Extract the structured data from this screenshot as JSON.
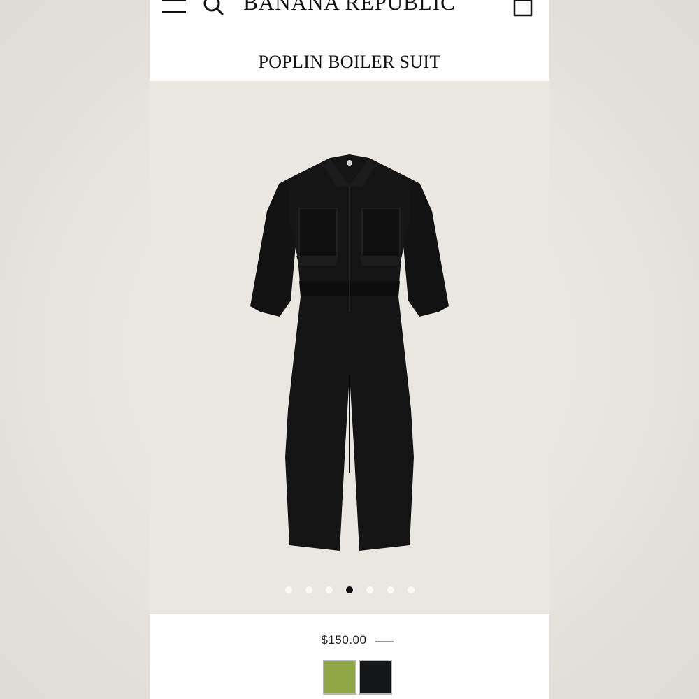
{
  "header": {
    "brand": "BANANA REPUBLIC",
    "icons": [
      "menu-icon",
      "search-icon",
      "shopping-bag-icon"
    ]
  },
  "product": {
    "title": "POPLIN BOILER SUIT",
    "price": "$150.00",
    "image": "black-poplin-boiler-suit"
  },
  "gallery": {
    "total_images": 7,
    "active_index": 4
  },
  "colors": {
    "swatches": [
      {
        "name": "green",
        "hex": "#8fa745"
      },
      {
        "name": "black",
        "hex": "#151617"
      }
    ],
    "background": "#eae7e3",
    "text": "#111111"
  }
}
